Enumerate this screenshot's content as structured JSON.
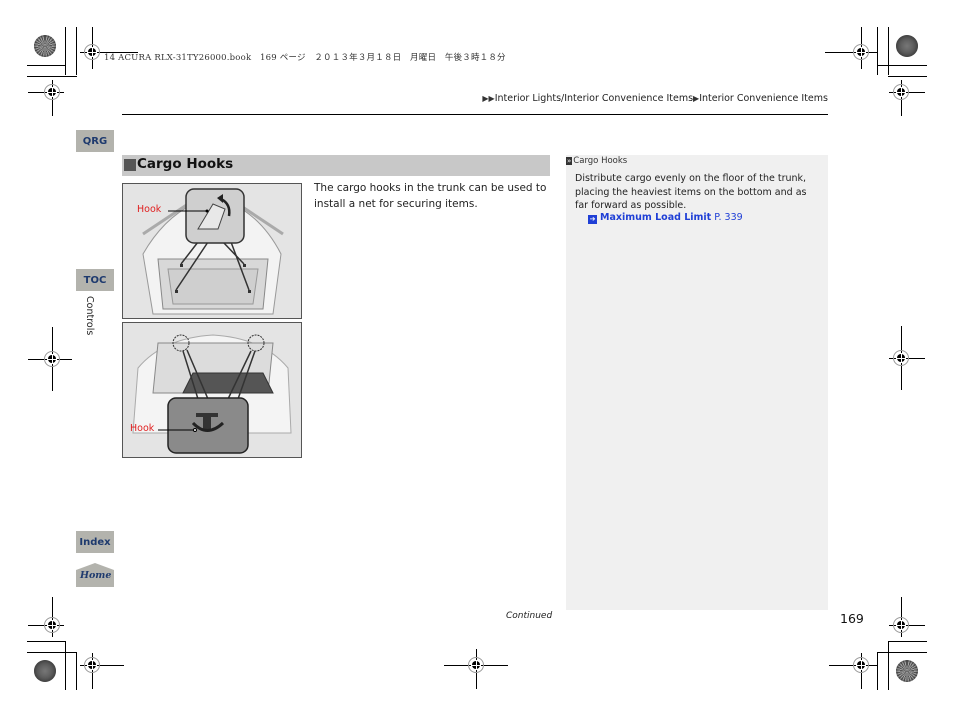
{
  "print_header": {
    "meta": "14 ACURA RLX-31TY26000.book　169 ページ　２０１３年３月１８日　月曜日　午後３時１８分"
  },
  "breadcrumb": {
    "arrow_prefix": "▶▶",
    "items": [
      "Interior Lights/Interior Convenience Items",
      "Interior Convenience Items"
    ],
    "separator": "▶"
  },
  "side_nav": {
    "qrg": "QRG",
    "toc": "TOC",
    "chapter": "Controls",
    "index": "Index",
    "home": "Home"
  },
  "section": {
    "title": "Cargo Hooks",
    "body": "The cargo hooks in the trunk can be used to install a net for securing items."
  },
  "figures": [
    {
      "label": "Hook",
      "description": "Hatchback trunk with four floor cargo hooks, inset showing hook"
    },
    {
      "label": "Hook",
      "description": "Sedan trunk with two upper cargo hooks, inset showing hook"
    }
  ],
  "sidebar": {
    "head_icon": "»",
    "heading": "Cargo Hooks",
    "body": "Distribute cargo evenly on the floor of the trunk, placing the heaviest items on the bottom and as far forward as possible.",
    "link_icon": "➔",
    "link_text": "Maximum Load Limit",
    "link_page": "P. 339"
  },
  "footer": {
    "continued": "Continued",
    "page_number": "169"
  },
  "colors": {
    "link": "#1f3fd6",
    "hook_label": "#e02020",
    "nav_button": "#b3b3ad",
    "nav_text": "#1e3a6e",
    "section_bar": "#c8c8c8",
    "sidebar_bg": "#f0f0f0"
  }
}
